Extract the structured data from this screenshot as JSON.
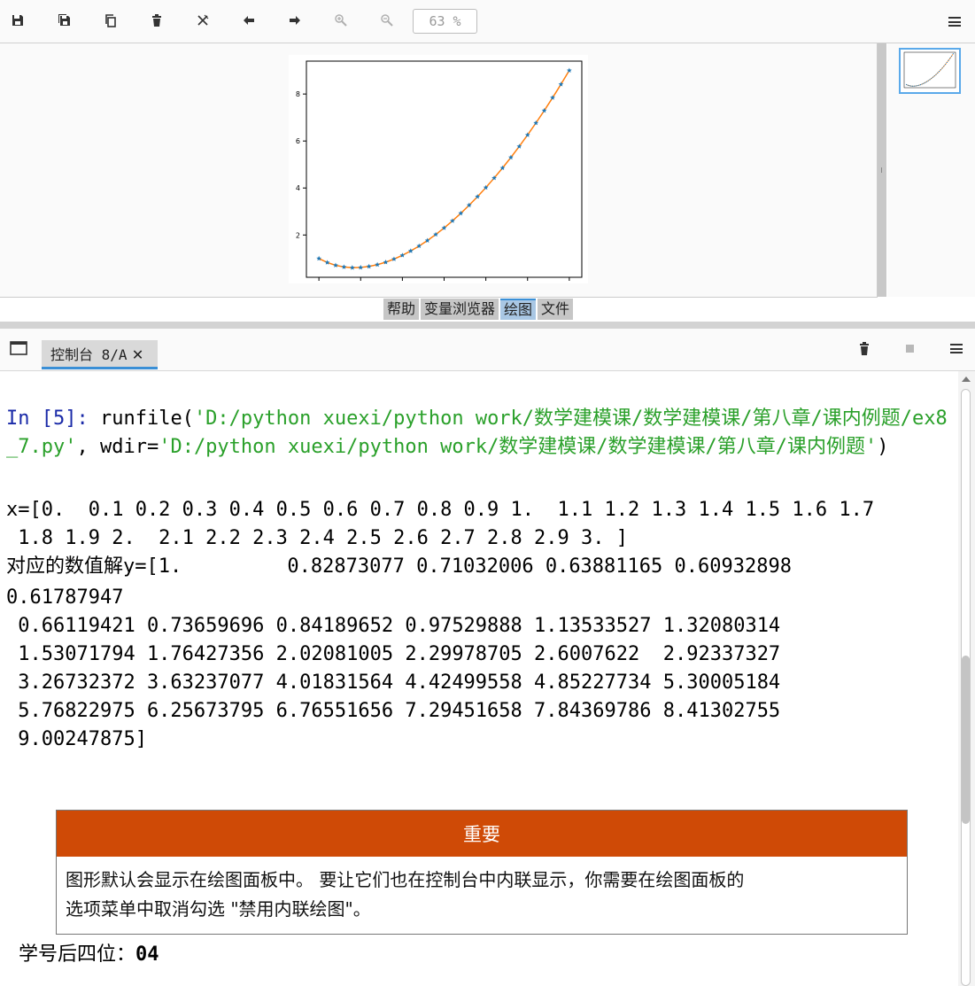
{
  "toolbar": {
    "zoom_value": "63 %",
    "icons": [
      "save-icon",
      "save-all-icon",
      "copy-icon",
      "delete-icon",
      "delete-all-icon",
      "previous-icon",
      "next-icon",
      "zoom-in-icon",
      "zoom-out-icon"
    ]
  },
  "plots_pane": {
    "tabs": [
      "帮助",
      "变量浏览器",
      "绘图",
      "文件"
    ],
    "active_tab": "绘图"
  },
  "chart_data": {
    "type": "line",
    "xlim": [
      -0.15,
      3.15
    ],
    "ylim": [
      0.2,
      9.4
    ],
    "x_ticks": [
      "0.0",
      "0.5",
      "1.0",
      "1.5",
      "2.0",
      "2.5",
      "3.0"
    ],
    "y_ticks": [
      "2",
      "4",
      "6",
      "8"
    ],
    "series": [
      {
        "style": "line+star-markers",
        "x": [
          0,
          0.1,
          0.2,
          0.3,
          0.4,
          0.5,
          0.6,
          0.7,
          0.8,
          0.9,
          1.0,
          1.1,
          1.2,
          1.3,
          1.4,
          1.5,
          1.6,
          1.7,
          1.8,
          1.9,
          2.0,
          2.1,
          2.2,
          2.3,
          2.4,
          2.5,
          2.6,
          2.7,
          2.8,
          2.9,
          3.0
        ],
        "y": [
          1.0,
          0.82873077,
          0.71032006,
          0.63881165,
          0.60932898,
          0.61787947,
          0.66119421,
          0.73659696,
          0.84189652,
          0.97529888,
          1.13533527,
          1.32080314,
          1.53071794,
          1.76427356,
          2.02081005,
          2.29978705,
          2.6007622,
          2.92337327,
          3.26732372,
          3.63237077,
          4.01831564,
          4.42499558,
          4.85227734,
          5.30005184,
          5.76822975,
          6.25673795,
          6.76551656,
          7.29451658,
          7.84369786,
          8.41302755,
          9.00247875
        ],
        "line_color": "#ff7f0e",
        "marker_color": "#1f77b4"
      }
    ]
  },
  "console": {
    "tab_label": "控制台 8/A",
    "prompt": "In [5]: ",
    "cmd_fn": "runfile(",
    "cmd_str1": "'D:/python xuexi/python work/数学建模课/数学建模课/第八章/课内例题/ex8_7.py'",
    "cmd_sep": ", wdir=",
    "cmd_str2": "'D:/python xuexi/python work/数学建模课/数学建模课/第八章/课内例题'",
    "cmd_end": ")",
    "output_lines": [
      "x=[0.  0.1 0.2 0.3 0.4 0.5 0.6 0.7 0.8 0.9 1.  1.1 1.2 1.3 1.4 1.5 1.6 1.7",
      " 1.8 1.9 2.  2.1 2.2 2.3 2.4 2.5 2.6 2.7 2.8 2.9 3. ]",
      "对应的数值解y=[1.         0.82873077 0.71032006 0.63881165 0.60932898",
      "0.61787947",
      " 0.66119421 0.73659696 0.84189652 0.97529888 1.13533527 1.32080314",
      " 1.53071794 1.76427356 2.02081005 2.29978705 2.6007622  2.92337327",
      " 3.26732372 3.63237077 4.01831564 4.42499558 4.85227734 5.30005184",
      " 5.76822975 6.25673795 6.76551656 7.29451658 7.84369786 8.41302755",
      " 9.00247875]"
    ],
    "important_title": "重要",
    "important_line1": "图形默认会显示在绘图面板中。 要让它们也在控制台中内联显示，你需要在绘图面板的",
    "important_line2": "选项菜单中取消勾选 \"禁用内联绘图\"。",
    "student_label": "学号后四位：",
    "student_value": "04"
  }
}
